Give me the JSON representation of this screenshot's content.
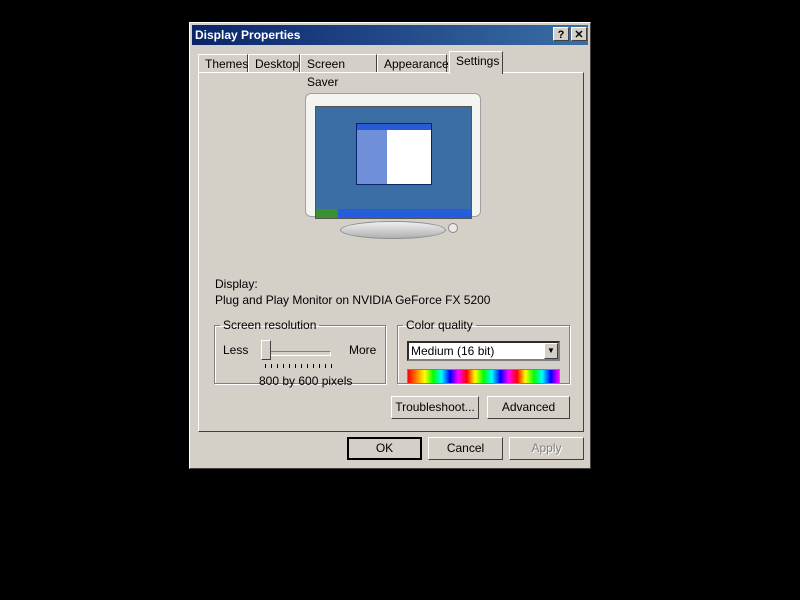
{
  "window": {
    "title": "Display Properties",
    "help_glyph": "?",
    "close_glyph": "✕"
  },
  "tabs": [
    {
      "label": "Themes"
    },
    {
      "label": "Desktop"
    },
    {
      "label": "Screen Saver"
    },
    {
      "label": "Appearance"
    },
    {
      "label": "Settings",
      "active": true
    }
  ],
  "display": {
    "label": "Display:",
    "value": "Plug and Play Monitor on NVIDIA GeForce FX 5200"
  },
  "screen_resolution": {
    "legend": "Screen resolution",
    "less_label": "Less",
    "more_label": "More",
    "value_text": "800 by 600 pixels",
    "slider_level": 0
  },
  "color_quality": {
    "legend": "Color quality",
    "selected": "Medium (16 bit)",
    "arrow_glyph": "▼"
  },
  "buttons": {
    "troubleshoot": "Troubleshoot...",
    "advanced": "Advanced",
    "ok": "OK",
    "cancel": "Cancel",
    "apply": "Apply"
  },
  "colors": {
    "title_active": "#0a246a",
    "dialog_face": "#d4d0c8",
    "desktop_preview": "#3a6ea5"
  }
}
